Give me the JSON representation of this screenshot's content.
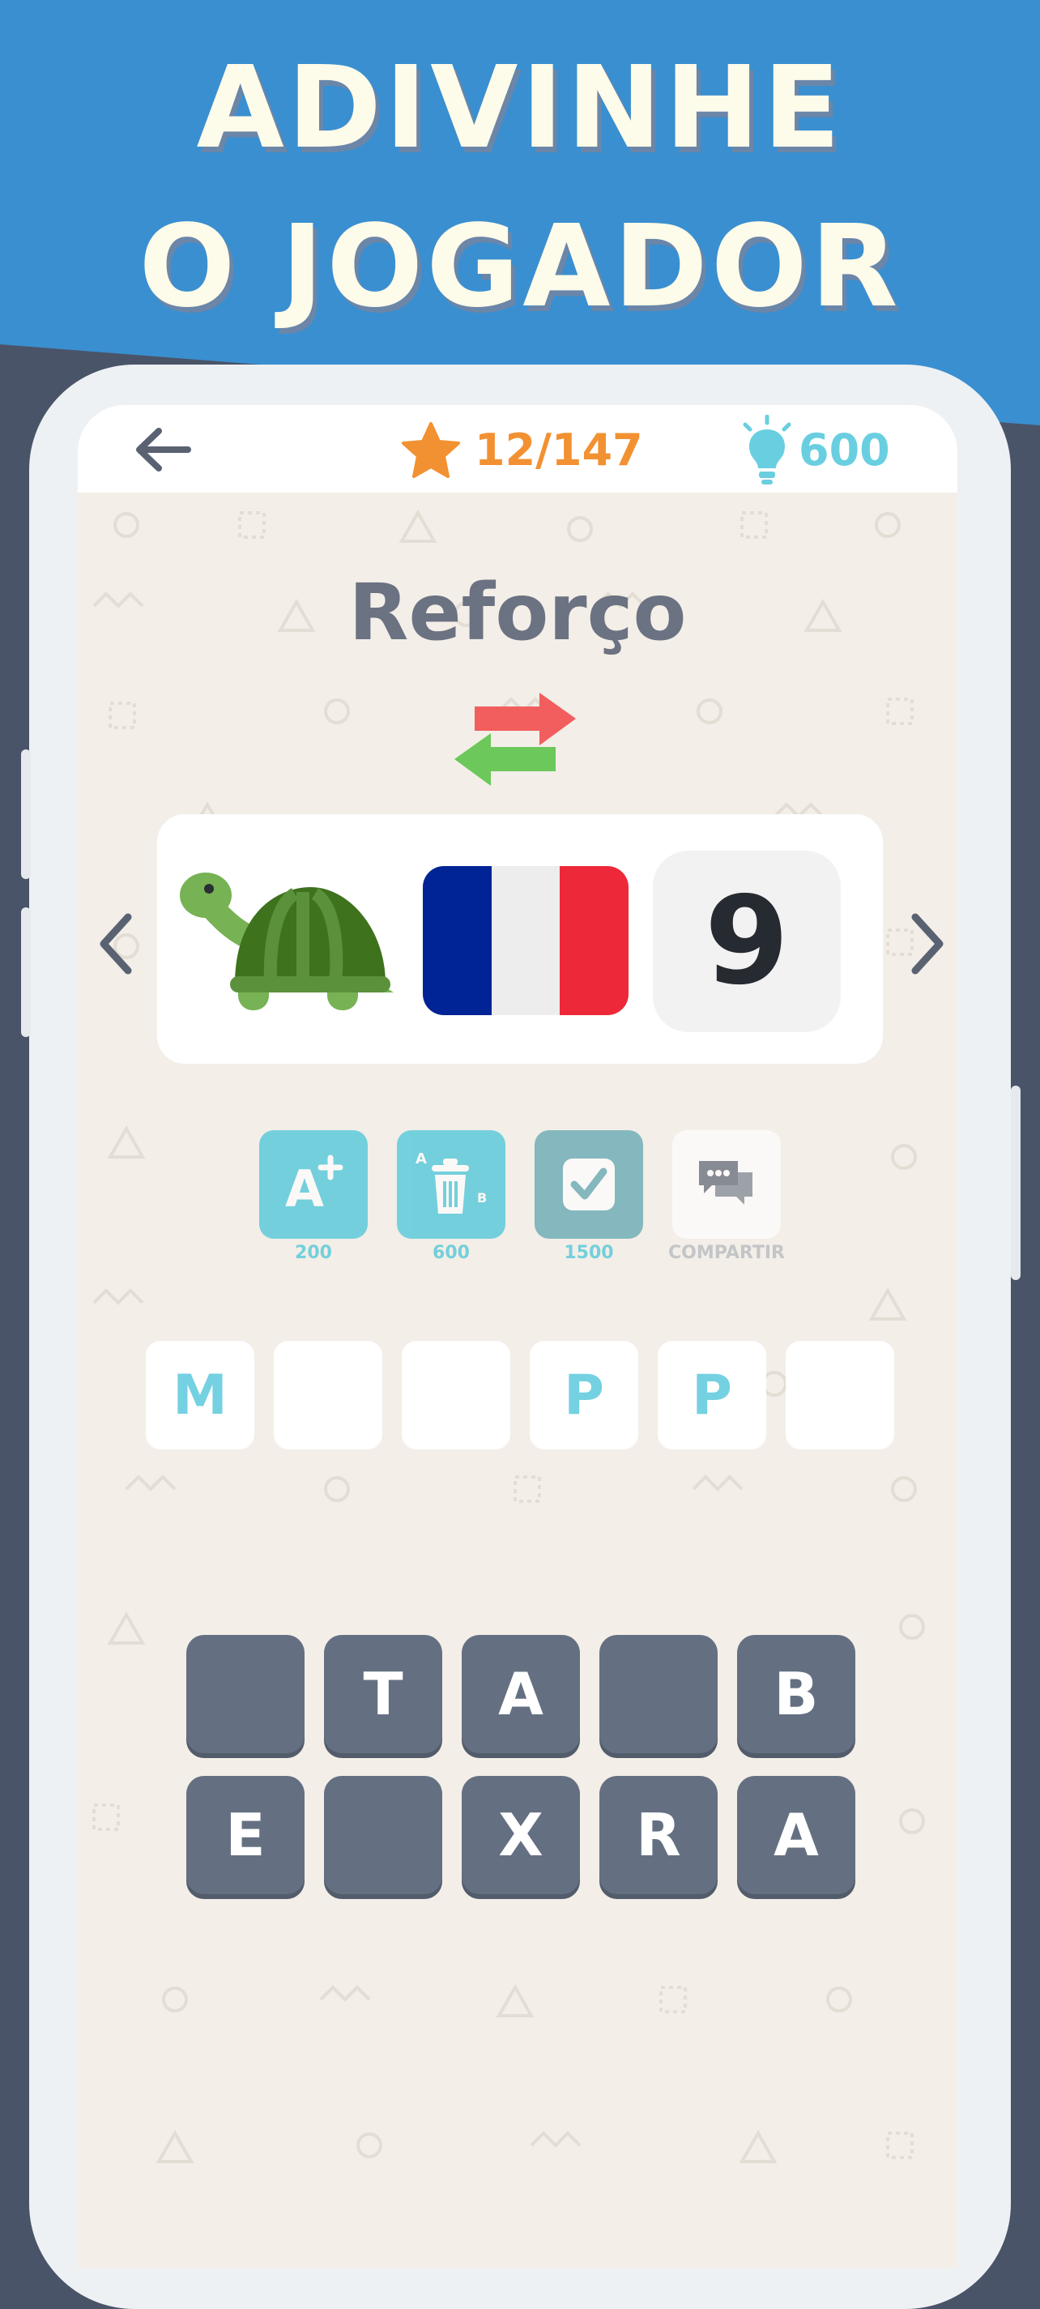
{
  "banner": {
    "line1": "ADIVINHE",
    "line2": "O JOGADOR",
    "background_color": "#3a8fd0"
  },
  "topbar": {
    "back_icon": "arrow-left-icon",
    "progress": "12/147",
    "coins": "600"
  },
  "puzzle": {
    "word": "Reforço",
    "clues": [
      {
        "icon": "turtle-icon"
      },
      {
        "icon": "france-flag-icon"
      },
      {
        "text": "9"
      }
    ]
  },
  "helpers": [
    {
      "icon": "add-letter-icon",
      "cost": "200"
    },
    {
      "icon": "remove-letters-icon",
      "cost": "600"
    },
    {
      "icon": "solve-check-icon",
      "cost": "1500"
    },
    {
      "icon": "share-chat-icon",
      "cost": "COMPARTIR"
    }
  ],
  "answer_slots": [
    "M",
    "",
    "",
    "P",
    "P",
    ""
  ],
  "keyboard": {
    "row1": [
      "",
      "T",
      "A",
      "",
      "B"
    ],
    "row2": [
      "E",
      "",
      "X",
      "R",
      "A"
    ]
  },
  "colors": {
    "accent_orange": "#f29132",
    "accent_cyan": "#69cfe0",
    "key_bg": "#647082"
  }
}
